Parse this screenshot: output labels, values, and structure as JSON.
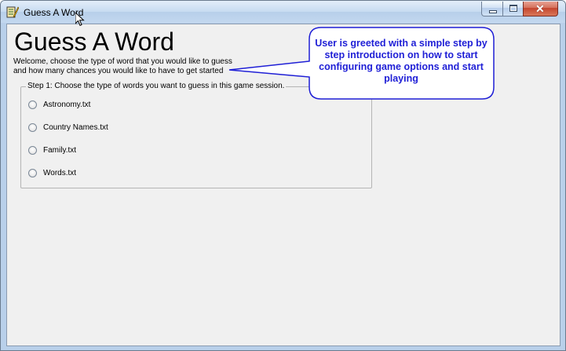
{
  "window": {
    "title": "Guess A Word"
  },
  "main": {
    "heading": "Guess A Word",
    "welcome_line1": "Welcome, choose the type of word that you would like to guess",
    "welcome_line2": "and how many chances you would like to have to get started",
    "step1": {
      "legend": "Step 1: Choose the type of words you want to guess in this game session.",
      "options": [
        {
          "label": "Astronomy.txt",
          "selected": false
        },
        {
          "label": "Country Names.txt",
          "selected": false
        },
        {
          "label": "Family.txt",
          "selected": false
        },
        {
          "label": "Words.txt",
          "selected": false
        }
      ]
    }
  },
  "callout": {
    "text": "User is greeted with a simple step by step introduction on how to start configuring game options and start playing",
    "text_color": "#1f1fd6",
    "border_color": "#1f1fd6"
  },
  "icons": {
    "app": "pencil-notebook-icon",
    "cursor": "mouse-pointer-icon"
  }
}
